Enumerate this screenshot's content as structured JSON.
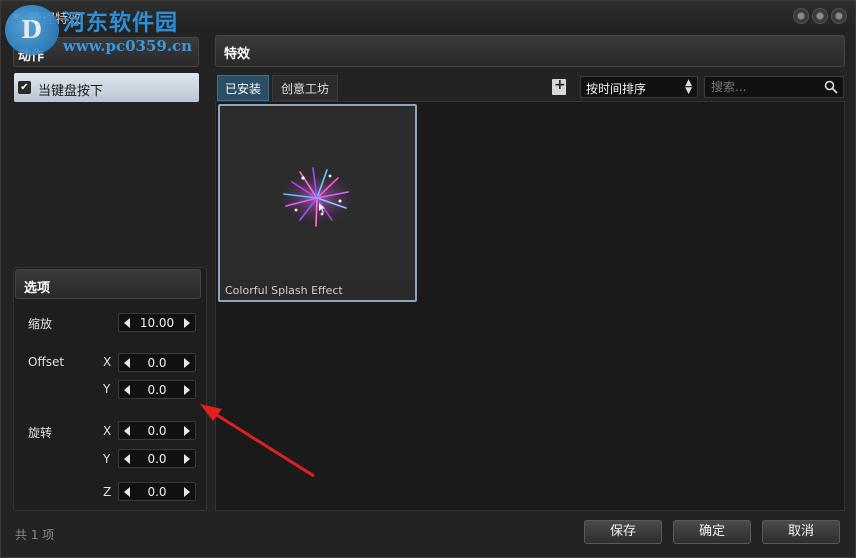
{
  "window": {
    "title": "管理特效"
  },
  "watermark": {
    "title": "河东软件园",
    "url": "www.pc0359.cn"
  },
  "left_panel": {
    "action_header": "动作",
    "action_item": "当键盘按下",
    "options_header": "选项",
    "scale_label": "缩放",
    "scale_value": "10.00",
    "offset_label": "Offset",
    "offset_x_label": "X",
    "offset_x": "0.0",
    "offset_y_label": "Y",
    "offset_y": "0.0",
    "rotation_label": "旋转",
    "rot_x_label": "X",
    "rot_x": "0.0",
    "rot_y_label": "Y",
    "rot_y": "0.0",
    "rot_z_label": "Z",
    "rot_z": "0.0",
    "count": "共 1 项"
  },
  "right_panel": {
    "header": "特效",
    "tabs": [
      "已安装",
      "创意工坊"
    ],
    "sort_value": "按时间排序",
    "search_placeholder": "搜索...",
    "effects": [
      {
        "name": "Colorful Splash Effect"
      }
    ]
  },
  "buttons": {
    "save": "保存",
    "ok": "确定",
    "cancel": "取消"
  },
  "colors": {
    "accent_tab": "#2a4e66",
    "annotation_arrow": "#e02020"
  }
}
